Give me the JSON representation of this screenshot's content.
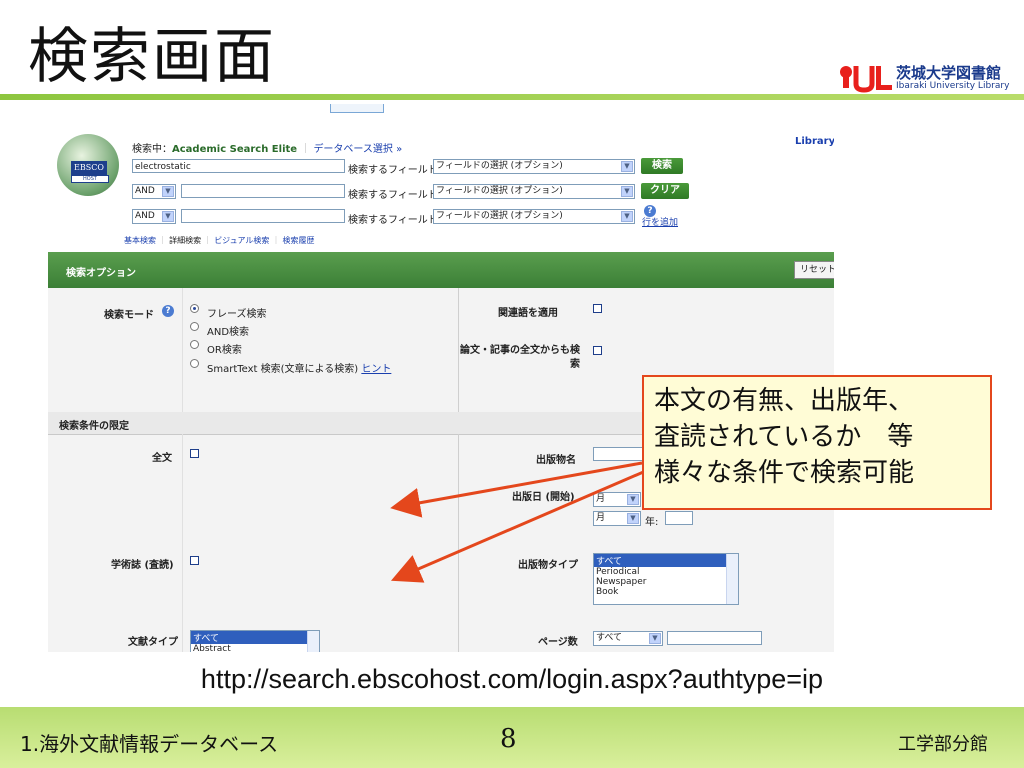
{
  "slide": {
    "title": "検索画面",
    "logo_text_jp": "茨城大学図書館",
    "logo_text_en": "Ibaraki University Library",
    "url": "http://search.ebscohost.com/login.aspx?authtype=ip",
    "footer_left": "1.海外文献情報データベース",
    "page_number": "8",
    "footer_right": "工学部分館",
    "callout_lines": [
      "本文の有無、出版年、",
      "査読されているか　等",
      "様々な条件で検索可能"
    ]
  },
  "ebsco": {
    "logo_top": "EBSCO",
    "logo_bottom": "HOST",
    "searching_label": "検索中：",
    "database": "Academic Search Elite",
    "db_select_link": "データベース選択 »",
    "library_link": "Library",
    "rows": [
      {
        "operator": "",
        "value": "electrostatic",
        "field_label": "検索するフィールド",
        "field_value": "フィールドの選択 (オプション)"
      },
      {
        "operator": "AND",
        "value": "",
        "field_label": "検索するフィールド",
        "field_value": "フィールドの選択 (オプション)"
      },
      {
        "operator": "AND",
        "value": "",
        "field_label": "検索するフィールド",
        "field_value": "フィールドの選択 (オプション)"
      }
    ],
    "search_button": "検索",
    "clear_button": "クリア",
    "add_row_link": "行を追加",
    "nav_links": [
      "基本検索",
      "詳細検索",
      "ビジュアル検索",
      "検索履歴"
    ],
    "options_header": "検索オプション",
    "reset_button": "リセット",
    "search_mode_label": "検索モード",
    "modes": [
      "フレーズ検索",
      "AND検索",
      "OR検索",
      "SmartText 検索(文章による検索)"
    ],
    "hint_link": "ヒント",
    "related_words_label": "関連語を適用",
    "fulltext_search_label": "論文・記事の全文からも検索",
    "limits_header": "検索条件の限定",
    "fulltext_label": "全文",
    "publication_name_label": "出版物名",
    "pubdate_label": "出版日 (開始)",
    "month_label": "月",
    "year_label": "年:",
    "peer_reviewed_label": "学術誌 (査読)",
    "pub_type_label": "出版物タイプ",
    "pub_types": [
      "すべて",
      "Periodical",
      "Newspaper",
      "Book"
    ],
    "doc_type_label": "文献タイプ",
    "doc_types": [
      "すべて",
      "Abstract"
    ],
    "page_count_label": "ページ数",
    "page_count_value": "すべて"
  }
}
